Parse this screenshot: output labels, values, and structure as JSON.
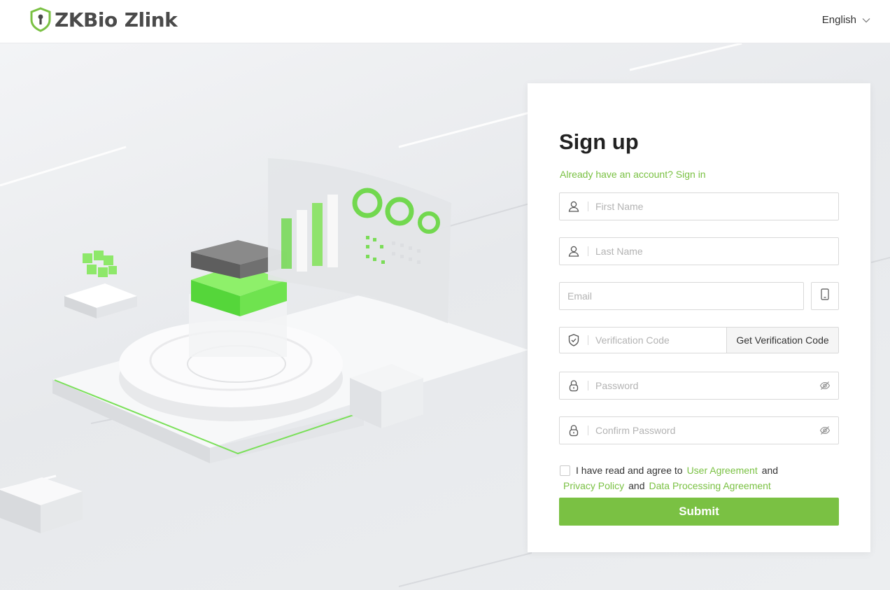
{
  "header": {
    "brand_name": "ZKBio",
    "product_name": "Zlink",
    "language": "English"
  },
  "signup": {
    "title": "Sign up",
    "signin_link": "Already have an account? Sign in",
    "first_name_placeholder": "First Name",
    "last_name_placeholder": "Last Name",
    "email_placeholder": "Email",
    "verification_placeholder": "Verification Code",
    "get_code_label": "Get Verification Code",
    "password_placeholder": "Password",
    "confirm_password_placeholder": "Confirm Password",
    "agree_text": "I have read and agree to",
    "user_agreement": "User Agreement",
    "and_1": "and",
    "privacy_policy": "Privacy Policy",
    "and_2": "and",
    "data_processing": "Data Processing Agreement",
    "submit_label": "Submit"
  },
  "icons": {
    "logo": "shield-lock-logo-icon",
    "language_dropdown": "chevron-down-icon",
    "first_name": "user-icon",
    "last_name": "user-icon",
    "switch_to_phone": "mobile-phone-icon",
    "verification": "shield-check-icon",
    "password": "lock-icon",
    "password_visibility": "eye-off-icon"
  },
  "colors": {
    "accent": "#7ac143",
    "text": "#222222",
    "border": "#d9d9d9",
    "placeholder": "#b3b3b3"
  }
}
